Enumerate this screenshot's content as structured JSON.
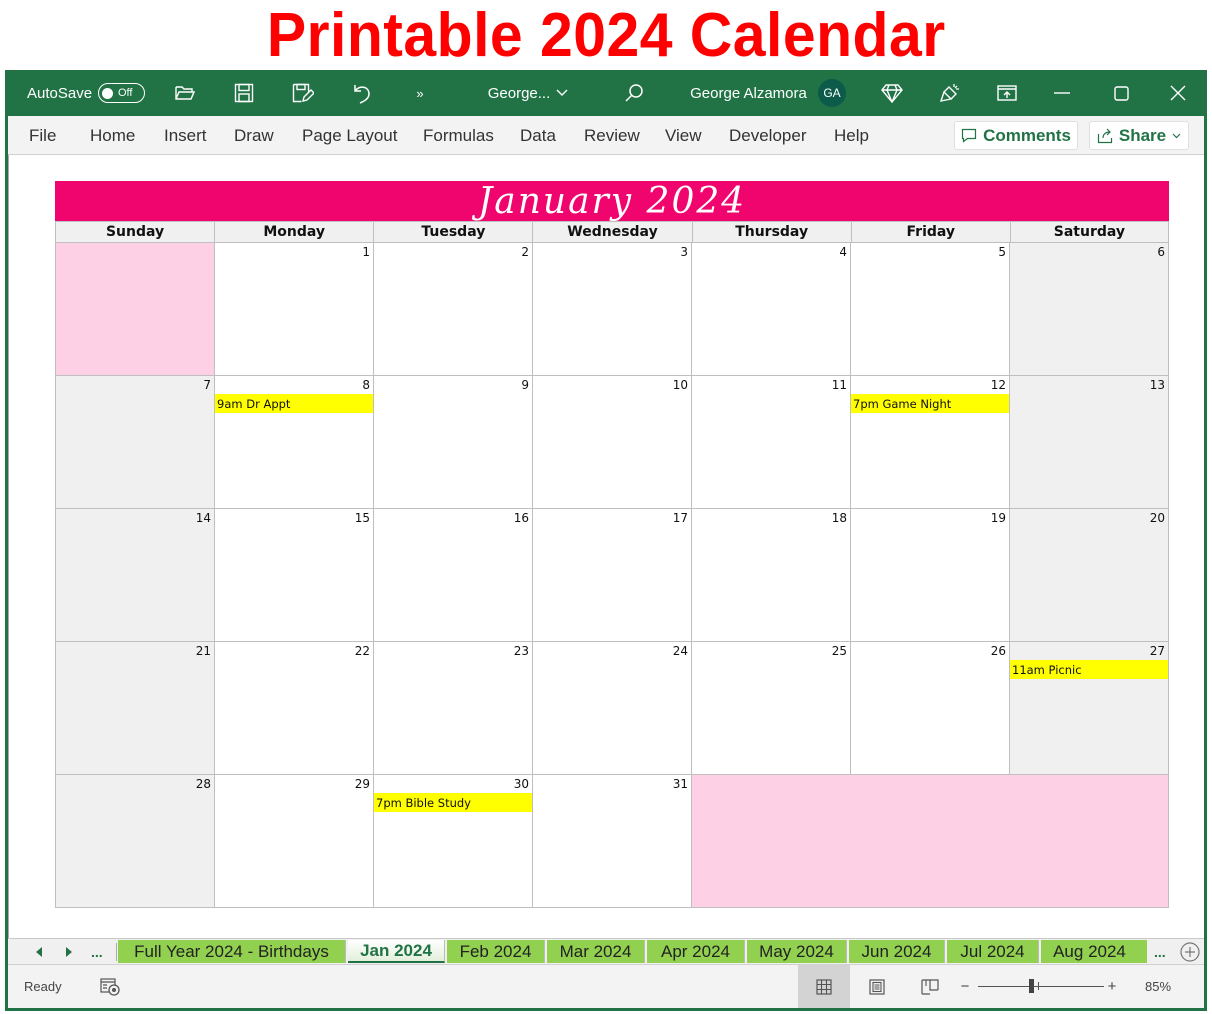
{
  "banner": {
    "title": "Printable 2024 Calendar"
  },
  "titlebar": {
    "autosave_label": "AutoSave",
    "autosave_state": "Off",
    "quick_access": [
      "open-icon",
      "save-icon",
      "save-as-icon",
      "undo-icon",
      "more-commands-icon"
    ],
    "doc_name": "George...",
    "search_icon": "search-icon",
    "user_name": "George Alzamora",
    "user_initials": "GA",
    "right_icons": [
      "premium-diamond-icon",
      "feedback-icon",
      "ribbon-display-icon",
      "minimize-icon",
      "maximize-icon",
      "close-icon"
    ]
  },
  "menu": {
    "items": [
      "File",
      "Home",
      "Insert",
      "Draw",
      "Page Layout",
      "Formulas",
      "Data",
      "Review",
      "View",
      "Developer",
      "Help"
    ],
    "comments_label": "Comments",
    "share_label": "Share"
  },
  "calendar": {
    "title": "January 2024",
    "weekdays": [
      "Sunday",
      "Monday",
      "Tuesday",
      "Wednesday",
      "Thursday",
      "Friday",
      "Saturday"
    ],
    "first_weekday_index": 1,
    "days_in_month": 31,
    "colors": {
      "title_bg": "#f0046e",
      "blank_bg": "#fdd0e6",
      "weekend_bg": "#f0f0f0",
      "event_bg": "#ffff00"
    },
    "events": [
      {
        "day": 8,
        "text": "9am Dr Appt"
      },
      {
        "day": 12,
        "text": "7pm Game Night"
      },
      {
        "day": 27,
        "text": "11am Picnic"
      },
      {
        "day": 30,
        "text": "7pm Bible Study"
      }
    ]
  },
  "sheet_tabs": {
    "nav": [
      "prev-sheet-icon",
      "next-sheet-icon"
    ],
    "ellipsis": "...",
    "tabs": [
      {
        "label": "Full Year 2024 - Birthdays",
        "active": false
      },
      {
        "label": "Jan 2024",
        "active": true
      },
      {
        "label": "Feb 2024",
        "active": false
      },
      {
        "label": "Mar 2024",
        "active": false
      },
      {
        "label": "Apr 2024",
        "active": false
      },
      {
        "label": "May 2024",
        "active": false
      },
      {
        "label": "Jun 2024",
        "active": false
      },
      {
        "label": "Jul 2024",
        "active": false
      },
      {
        "label": "Aug 2024",
        "active": false
      }
    ],
    "more": "...",
    "add_sheet_icon": "add-sheet-icon"
  },
  "status": {
    "ready": "Ready",
    "accessibility_icon": "accessibility-check-icon",
    "views": [
      "normal-view-icon",
      "page-layout-view-icon",
      "page-break-preview-icon"
    ],
    "active_view": "normal-view-icon",
    "zoom_out": "−",
    "zoom_in": "+",
    "zoom_level": "85%",
    "zoom_percent": 85
  }
}
